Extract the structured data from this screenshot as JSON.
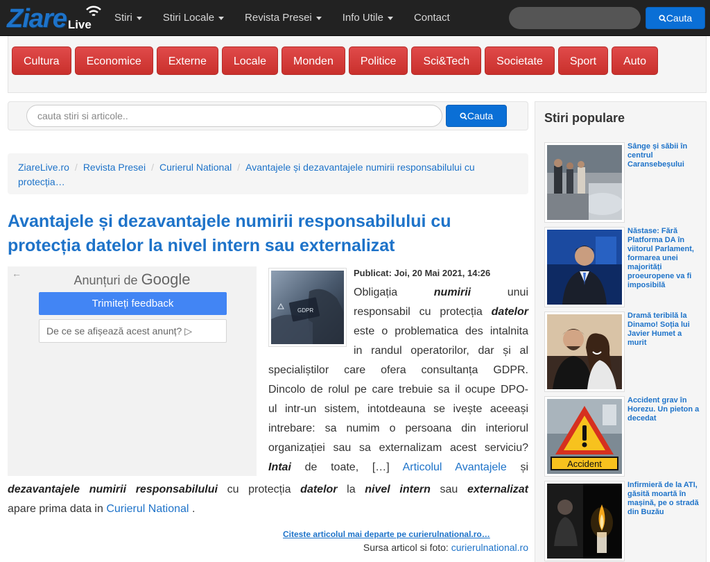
{
  "logo": {
    "main": "Ziare",
    "sub": "Live"
  },
  "nav": {
    "items": [
      {
        "label": "Stiri",
        "dropdown": true
      },
      {
        "label": "Stiri Locale",
        "dropdown": true
      },
      {
        "label": "Revista Presei",
        "dropdown": true
      },
      {
        "label": "Info Utile",
        "dropdown": true
      },
      {
        "label": "Contact",
        "dropdown": false
      }
    ],
    "search_button": "Cauta"
  },
  "categories": [
    "Cultura",
    "Economice",
    "Externe",
    "Locale",
    "Monden",
    "Politice",
    "Sci&Tech",
    "Societate",
    "Sport",
    "Auto"
  ],
  "search": {
    "placeholder": "cauta stiri si articole..",
    "button": "Cauta"
  },
  "breadcrumb": [
    "ZiareLive.ro",
    "Revista Presei",
    "Curierul National",
    "Avantajele și dezavantajele numirii responsabilului cu protecția…"
  ],
  "article": {
    "title": "Avantajele și dezavantajele numirii responsabilului cu protecția datelor la nivel intern sau externalizat",
    "published": "Publicat: Joi, 20 Mai 2021, 14:26",
    "thumb_text": "GDPR",
    "p1_a": "Obligația",
    "p1_b": "numirii",
    "p1_c": "unui",
    "p2_a": "responsabil cu protecția",
    "p2_b": "datelor",
    "p3": "este o problematica des intalnita",
    "p4": "in randul operatorilor, dar și al",
    "p5": "specialiștilor care ofera consultanța GDPR.",
    "p6": "Dincolo de rolul pe care trebuie sa il ocupe DPO-",
    "p7": "ul intr-un sistem, intotdeauna se ivește aceeași",
    "p8": "intrebare: sa numim o persoana din interiorul",
    "p9": "organizației sau sa externalizam acest serviciu?",
    "p10_a": "Intai",
    "p10_b": "de toate, […]",
    "p10_link": "Articolul Avantajele",
    "p10_c": "și",
    "p11_a": "dezavantajele numirii responsabilului",
    "p11_b": "cu protecția",
    "p11_c": "datelor",
    "p11_d": "la",
    "p11_e": "nivel intern",
    "p11_f": "sau",
    "p11_g": "externalizat",
    "p12_a": "apare prima data in",
    "p12_link": "Curierul National",
    "p12_b": ".",
    "read_more": "Citeste articolul mai departe pe curierulnational.ro…",
    "source_label": "Sursa articol si foto:",
    "source_link": "curierulnational.ro"
  },
  "ad": {
    "back": "←",
    "label": "Anunțuri de",
    "brand": "Google",
    "feedback": "Trimiteți feedback",
    "why": "De ce se afișează acest anunț? ▷"
  },
  "sidebar": {
    "title": "Stiri populare",
    "items": [
      {
        "title": "Sânge și săbii în centrul Caransebeșului"
      },
      {
        "title": "Năstase: Fără Platforma DA în viitorul Parlament, formarea unei majorități proeuropene va fi imposibilă"
      },
      {
        "title": "Dramă teribilă la Dinamo! Soția lui Javier Humet a murit"
      },
      {
        "title": "Accident grav în Horezu. Un pieton a decedat"
      },
      {
        "title": "Infirmieră de la ATI, găsită moartă în mașină, pe o stradă din Buzău"
      }
    ],
    "accident_sign_text": "Accident"
  },
  "colors": {
    "brand": "#1e73c9",
    "category": "#d9383a",
    "navbar": "#222222",
    "button": "#0a6fd6"
  }
}
